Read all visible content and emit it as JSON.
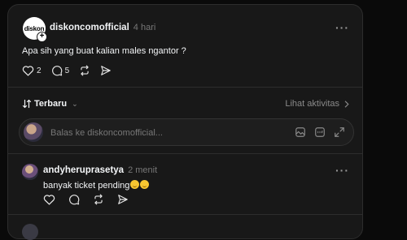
{
  "post": {
    "logo_text": "diskon",
    "username": "diskoncomofficial",
    "time": "4 hari",
    "text": "Apa sih yang buat kalian males ngantor ?",
    "likes": "2",
    "comments": "5"
  },
  "sort": {
    "label": "Terbaru",
    "activity_label": "Lihat aktivitas"
  },
  "reply": {
    "placeholder": "Balas ke diskoncomofficial..."
  },
  "comment": {
    "username": "andyheruprasetya",
    "time": "2 menit",
    "text": "banyak ticket pending"
  },
  "colors": {
    "background": "#0a0a0a",
    "card": "#181818",
    "text": "#f3f5f7",
    "muted": "#777777"
  }
}
